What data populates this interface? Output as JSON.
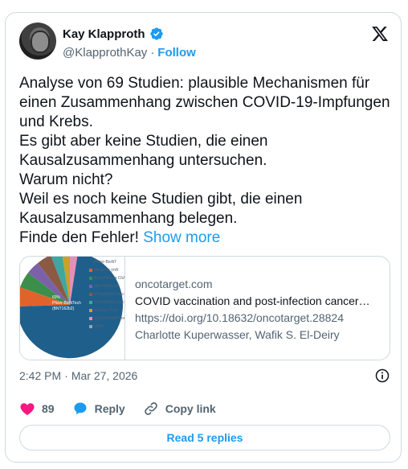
{
  "author": {
    "display_name": "Kay Klapproth",
    "handle": "@KlapprothKay",
    "separator": "·",
    "follow_label": "Follow"
  },
  "tweet": {
    "text": "Analyse von 69 Studien: plausible Mechanismen für einen Zusammenhang zwischen COVID-19-Impfungen und Krebs.\nEs gibt aber keine Studien, die einen Kausalzusammenhang untersuchen.\nWarum nicht?\nWeil es noch keine Studien gibt, die einen Kausalzusammenhang belegen.\nFinde den Fehler! ",
    "show_more": "Show more"
  },
  "link_card": {
    "domain": "oncotarget.com",
    "title": "COVID vaccination and post-infection cancer…",
    "url": "https://doi.org/10.18632/oncotarget.28824",
    "authors": "Charlotte Kuperwasser, Wafik S. El-Deiry",
    "thumbnail": {
      "pie_label_pct": "60%",
      "pie_label_line1": "Pfizer-BioNTech",
      "pie_label_line2": "(BNT162b2)",
      "legend": [
        {
          "label": "Pfizer-BioNT",
          "color": "#1f5f8b"
        },
        {
          "label": "Moderna (mR",
          "color": "#e2622b"
        },
        {
          "label": "AstraZeneca ChAdOx1/Cor",
          "color": "#3b8f4a"
        },
        {
          "label": "J&J/ Ad26.CO",
          "color": "#7b61a8"
        },
        {
          "label": "Unspecified vaccine type not spe",
          "color": "#8a5a44"
        },
        {
          "label": "Unspecified vaccine",
          "color": "#3fa7a0"
        },
        {
          "label": "Sinovac/ Con",
          "color": "#c9a227"
        },
        {
          "label": "Sinopharm/B CorV",
          "color": "#e58fb8"
        },
        {
          "label": "Other",
          "color": "#9aa3aa"
        }
      ]
    }
  },
  "meta": {
    "time": "2:42 PM",
    "separator": "·",
    "date": "Mar 27, 2026"
  },
  "actions": {
    "like_count": "89",
    "reply_label": "Reply",
    "copy_link_label": "Copy link"
  },
  "read_replies_label": "Read 5 replies",
  "colors": {
    "accent": "#1d9bf0",
    "like": "#f91880",
    "text": "#0f1419",
    "muted": "#536471",
    "border": "#cfd9de"
  }
}
